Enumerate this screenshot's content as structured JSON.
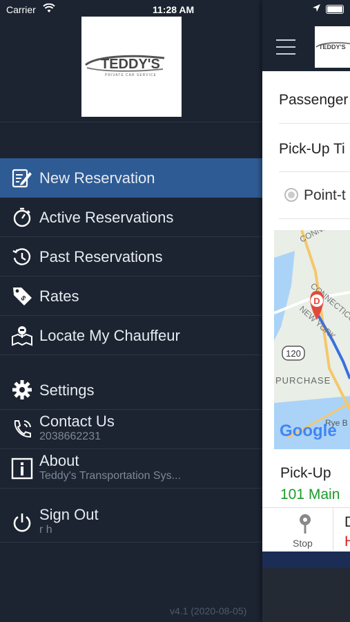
{
  "status_bar": {
    "carrier": "Carrier",
    "time": "11:28 AM"
  },
  "brand": {
    "logo_text": "TEDDY'S",
    "logo_subtext": "PRIVATE CAR SERVICE"
  },
  "menu": {
    "primary": [
      {
        "label": "New Reservation",
        "icon": "edit-document-icon",
        "active": true
      },
      {
        "label": "Active Reservations",
        "icon": "stopwatch-icon",
        "active": false
      },
      {
        "label": "Past Reservations",
        "icon": "history-clock-icon",
        "active": false
      },
      {
        "label": "Rates",
        "icon": "price-tag-icon",
        "active": false
      },
      {
        "label": "Locate My Chauffeur",
        "icon": "map-chauffeur-icon",
        "active": false
      }
    ],
    "settings": {
      "label": "Settings",
      "icon": "gear-icon"
    },
    "contact": {
      "label": "Contact Us",
      "sub": "2038662231",
      "icon": "phone-icon"
    },
    "about": {
      "label": "About",
      "sub": "Teddy's Transportation Sys...",
      "icon": "info-icon"
    },
    "signout": {
      "label": "Sign Out",
      "sub": "r h",
      "icon": "power-icon"
    }
  },
  "version": "v4.1 (2020-08-05)",
  "main": {
    "passenger_label": "Passenger",
    "pickup_time_label": "Pick-Up Ti",
    "trip_type_option": "Point-t",
    "pickup_label": "Pick-Up",
    "pickup_address": "101 Main",
    "stop_label": "Stop",
    "dropoff_initial": "D",
    "dropoff_initial_red": "H",
    "map": {
      "route_shield": "120",
      "place_purchase": "PURCHASE",
      "label_connecticut": "CONNECTICUT",
      "label_new_york": "NEW YORK",
      "label_rye": "Rye B",
      "marker_letter": "D",
      "attribution": "Google"
    }
  },
  "colors": {
    "drawer_bg": "#1c2431",
    "active_item": "#2e5b94",
    "pickup_green": "#1a9a2a",
    "alert_red": "#d9201a"
  }
}
